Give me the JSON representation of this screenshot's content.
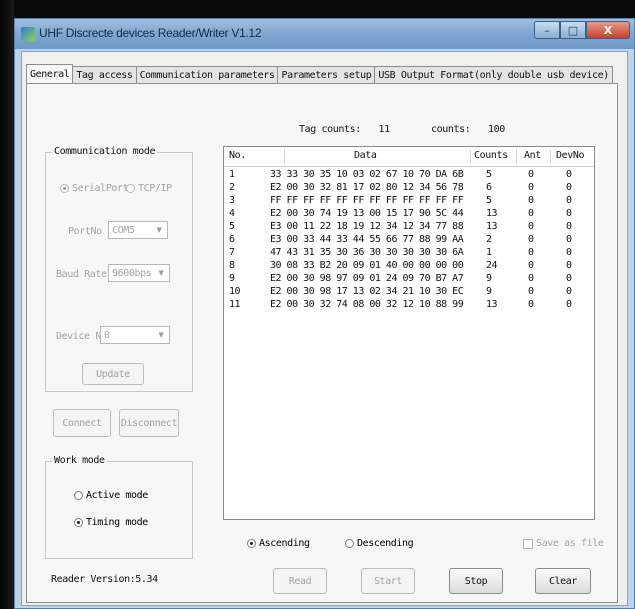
{
  "window": {
    "title": "UHF Discrecte devices Reader/Writer V1.12",
    "controls": {
      "minimize": "–",
      "maximize": "□",
      "close": "X"
    }
  },
  "tabs": [
    {
      "label": "General",
      "active": true
    },
    {
      "label": "Tag access",
      "active": false
    },
    {
      "label": "Communication parameters",
      "active": false
    },
    {
      "label": "Parameters setup",
      "active": false
    },
    {
      "label": "USB Output Format(only double usb device)",
      "active": false
    }
  ],
  "communication": {
    "group_label": "Communication mode",
    "serial_label": "SerialPort",
    "tcp_label": "TCP/IP",
    "selected": "SerialPort",
    "port_label": "PortNo",
    "port_value": "COM5",
    "baud_label": "Baud Rate",
    "baud_value": "9600bps",
    "device_label": "Device No",
    "device_value": "0",
    "update_label": "Update"
  },
  "connect_label": "Connect",
  "disconnect_label": "Disconnect",
  "work_mode": {
    "group_label": "Work mode",
    "active_label": "Active mode",
    "timing_label": "Timing mode",
    "selected": "Timing mode"
  },
  "reader_version": "Reader Version:5.34",
  "counts_bar": {
    "tag_counts_label": "Tag counts:",
    "tag_counts_value": "11",
    "counts_label": "counts:",
    "counts_value": "100"
  },
  "table": {
    "columns": [
      "No.",
      "Data",
      "Counts",
      "Ant",
      "DevNo"
    ],
    "rows": [
      {
        "no": "1",
        "data": "33 33 30 35 10 03 02 67 10 70 DA 6B",
        "counts": "5",
        "ant": "0",
        "devno": "0"
      },
      {
        "no": "2",
        "data": "E2 00 30 32 81 17 02 80 12 34 56 78",
        "counts": "6",
        "ant": "0",
        "devno": "0"
      },
      {
        "no": "3",
        "data": "FF FF FF FF FF FF FF FF FF FF FF FF",
        "counts": "5",
        "ant": "0",
        "devno": "0"
      },
      {
        "no": "4",
        "data": "E2 00 30 74 19 13 00 15 17 90 5C 44",
        "counts": "13",
        "ant": "0",
        "devno": "0"
      },
      {
        "no": "5",
        "data": "E3 00 11 22 18 19 12 34 12 34 77 88",
        "counts": "13",
        "ant": "0",
        "devno": "0"
      },
      {
        "no": "6",
        "data": "E3 00 33 44 33 44 55 66 77 88 99 AA",
        "counts": "2",
        "ant": "0",
        "devno": "0"
      },
      {
        "no": "7",
        "data": "47 43 31 35 30 36 30 30 30 30 30 6A",
        "counts": "1",
        "ant": "0",
        "devno": "0"
      },
      {
        "no": "8",
        "data": "30 08 33 B2 20 09 01 40 00 00 00 00",
        "counts": "24",
        "ant": "0",
        "devno": "0"
      },
      {
        "no": "9",
        "data": "E2 00 30 98 97 09 01 24 09 70 B7 A7",
        "counts": "9",
        "ant": "0",
        "devno": "0"
      },
      {
        "no": "10",
        "data": "E2 00 30 98 17 13 02 34 21 10 30 EC",
        "counts": "9",
        "ant": "0",
        "devno": "0"
      },
      {
        "no": "11",
        "data": "E2 00 30 32 74 08 00 32 12 10 88 99",
        "counts": "13",
        "ant": "0",
        "devno": "0"
      }
    ]
  },
  "sort": {
    "ascending_label": "Ascending",
    "descending_label": "Descending",
    "selected": "Ascending"
  },
  "save_file_label": "Save as file",
  "buttons": {
    "read": "Read",
    "start": "Start",
    "stop": "Stop",
    "clear": "Clear"
  },
  "colors": {
    "title_bar": "#7fa6d1",
    "close_button": "#c8412b",
    "panel_background": "#f7f7f7",
    "disabled_text": "#a3a3a3"
  }
}
